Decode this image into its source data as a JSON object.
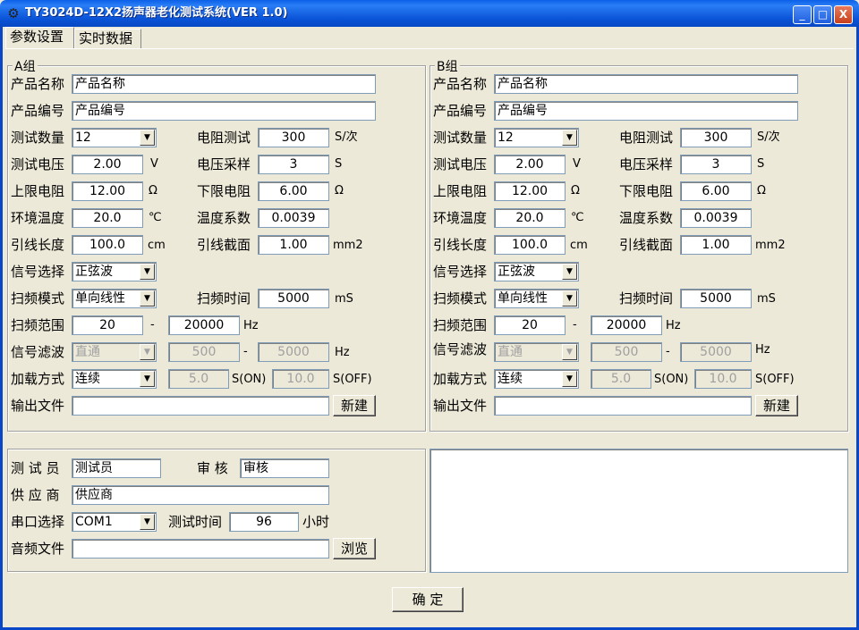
{
  "window": {
    "title": "TY3024D-12X2扬声器老化测试系统(VER 1.0)",
    "minimize": "_",
    "maximize": "□",
    "close": "X"
  },
  "tabs": [
    {
      "label": "参数设置"
    },
    {
      "label": "实时数据"
    }
  ],
  "labels": {
    "product_name": "产品名称",
    "product_code": "产品编号",
    "test_count": "测试数量",
    "test_voltage": "测试电压",
    "upper_resistance": "上限电阻",
    "env_temp": "环境温度",
    "lead_length": "引线长度",
    "signal_select": "信号选择",
    "sweep_mode": "扫频模式",
    "sweep_range": "扫频范围",
    "signal_filter": "信号滤波",
    "load_mode": "加载方式",
    "output_file": "输出文件",
    "resistance_test": "电阻测试",
    "voltage_sample": "电压采样",
    "lower_resistance": "下限电阻",
    "temp_coef": "温度系数",
    "lead_section": "引线截面",
    "sweep_time": "扫频时间",
    "dash": "-",
    "new_button": "新建"
  },
  "units": {
    "s_per_time": "S/次",
    "v": "V",
    "s": "S",
    "ohm": "Ω",
    "celsius": "℃",
    "cm": "cm",
    "mm2": "mm2",
    "ms": "mS",
    "hz": "Hz",
    "s_on": "S(ON)",
    "s_off": "S(OFF)"
  },
  "groupA": {
    "title": "A组",
    "product_name": "产品名称",
    "product_code": "产品编号",
    "test_count": "12",
    "test_voltage": "2.00",
    "upper_resistance": "12.00",
    "env_temp": "20.0",
    "lead_length": "100.0",
    "signal_select": "正弦波",
    "sweep_mode": "单向线性",
    "sweep_from": "20",
    "sweep_to": "20000",
    "filter_mode": "直通",
    "filter_from": "500",
    "filter_to": "5000",
    "load_mode": "连续",
    "on_time": "5.0",
    "off_time": "10.0",
    "output_file": "",
    "resistance_test": "300",
    "voltage_sample": "3",
    "lower_resistance": "6.00",
    "temp_coef": "0.0039",
    "lead_section": "1.00",
    "sweep_time": "5000"
  },
  "groupB": {
    "title": "B组",
    "product_name": "产品名称",
    "product_code": "产品编号",
    "test_count": "12",
    "test_voltage": "2.00",
    "upper_resistance": "12.00",
    "env_temp": "20.0",
    "lead_length": "100.0",
    "signal_select": "正弦波",
    "sweep_mode": "单向线性",
    "sweep_from": "20",
    "sweep_to": "20000",
    "filter_mode": "直通",
    "filter_from": "500",
    "filter_to": "5000",
    "load_mode": "连续",
    "on_time": "5.0",
    "off_time": "10.0",
    "output_file": "",
    "resistance_test": "300",
    "voltage_sample": "3",
    "lower_resistance": "6.00",
    "temp_coef": "0.0039",
    "lead_section": "1.00",
    "sweep_time": "5000"
  },
  "bottom": {
    "tester_label": "测 试 员",
    "tester": "测试员",
    "reviewer_label": "审 核",
    "reviewer": "审核",
    "supplier_label": "供 应 商",
    "supplier": "供应商",
    "port_label": "串口选择",
    "port": "COM1",
    "test_time_label": "测试时间",
    "test_time": "96",
    "hours": "小时",
    "audio_label": "音频文件",
    "audio_file": "",
    "browse": "浏览"
  },
  "confirm": "确 定"
}
